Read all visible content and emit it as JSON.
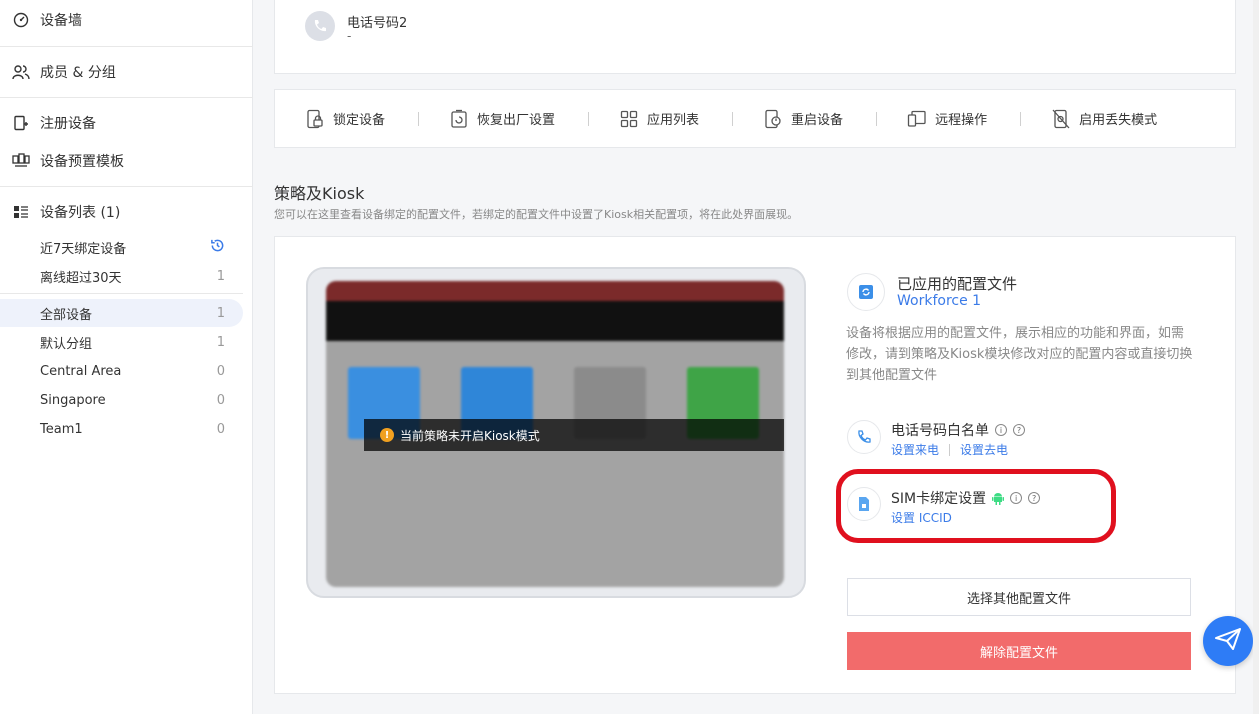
{
  "sidebar": {
    "items": [
      {
        "label": "设备墙",
        "icon": "dashboard-icon"
      },
      {
        "label": "成员 & 分组",
        "icon": "users-icon"
      },
      {
        "label": "注册设备",
        "icon": "add-device-icon"
      },
      {
        "label": "设备预置模板",
        "icon": "template-icon"
      },
      {
        "label": "设备列表 (1)",
        "icon": "list-icon"
      }
    ],
    "groups": [
      {
        "label": "近7天绑定设备",
        "count": ""
      },
      {
        "label": "离线超过30天",
        "count": "1"
      },
      {
        "label": "全部设备",
        "count": "1"
      },
      {
        "label": "默认分组",
        "count": "1"
      },
      {
        "label": "Central Area",
        "count": "0"
      },
      {
        "label": "Singapore",
        "count": "0"
      },
      {
        "label": "Team1",
        "count": "0"
      }
    ]
  },
  "phone": {
    "label": "电话号码2",
    "value": "-"
  },
  "actions": [
    {
      "label": "锁定设备",
      "icon": "lock-device-icon"
    },
    {
      "label": "恢复出厂设置",
      "icon": "factory-reset-icon"
    },
    {
      "label": "应用列表",
      "icon": "app-list-icon"
    },
    {
      "label": "重启设备",
      "icon": "reboot-icon"
    },
    {
      "label": "远程操作",
      "icon": "remote-control-icon"
    },
    {
      "label": "启用丢失模式",
      "icon": "lost-mode-icon"
    }
  ],
  "policy": {
    "title": "策略及Kiosk",
    "description": "您可以在这里查看设备绑定的配置文件，若绑定的配置文件中设置了Kiosk相关配置项，将在此处界面展现。",
    "preview_notice": "当前策略未开启Kiosk模式",
    "applied_title": "已应用的配置文件",
    "applied_name": "Workforce 1",
    "applied_desc": "设备将根据应用的配置文件，展示相应的功能和界面，如需修改，请到策略及Kiosk模块修改对应的配置内容或直接切换到其他配置文件",
    "whitelist_title": "电话号码白名单",
    "whitelist_link_in": "设置来电",
    "whitelist_link_out": "设置去电",
    "sim_title": "SIM卡绑定设置",
    "sim_link": "设置 ICCID",
    "btn_other": "选择其他配置文件",
    "btn_remove": "解除配置文件"
  },
  "colors": {
    "accent": "#3b7be8",
    "danger": "#f26b6b",
    "highlight": "#e0101e",
    "android": "#3ddc84"
  }
}
